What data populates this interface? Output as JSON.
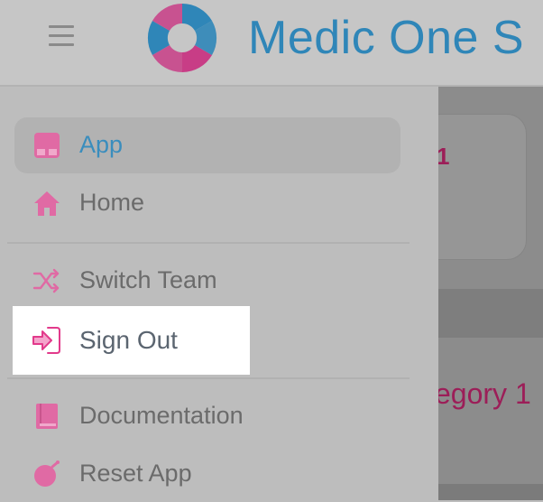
{
  "header": {
    "menu_icon": "hamburger-menu-icon",
    "logo_icon": "medic-one-logo-icon",
    "brand_text": "Medic One S"
  },
  "background": {
    "card_text": "1",
    "category_text": "egory 1"
  },
  "menu": {
    "items": [
      {
        "label": "App",
        "icon": "app-icon",
        "selected": true
      },
      {
        "label": "Home",
        "icon": "home-icon"
      },
      {
        "label": "Switch Team",
        "icon": "shuffle-icon"
      },
      {
        "label": "Sign Out",
        "icon": "sign-in-arrow-icon",
        "highlighted": true
      },
      {
        "label": "Documentation",
        "icon": "book-icon"
      },
      {
        "label": "Reset App",
        "icon": "reset-icon"
      }
    ]
  },
  "colors": {
    "brand_blue": "#2f86b8",
    "accent_pink": "#e23a8b",
    "selected_label": "#3a8dbd"
  }
}
